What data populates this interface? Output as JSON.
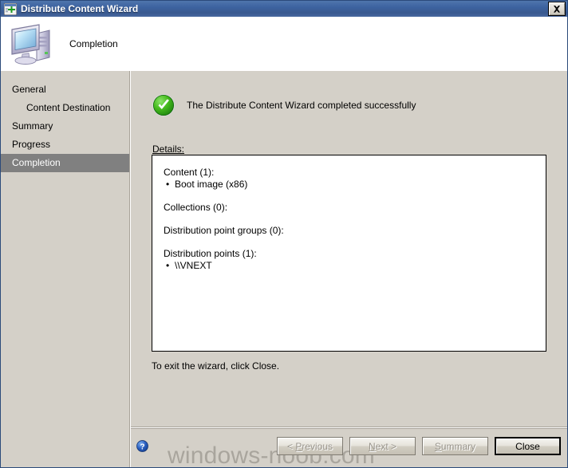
{
  "window": {
    "title": "Distribute Content Wizard",
    "title_icon": "wizard-window-plus-icon",
    "close_label": "X"
  },
  "header": {
    "title": "Completion",
    "icon": "computer-icon"
  },
  "sidebar": {
    "items": [
      {
        "label": "General",
        "sub": false,
        "active": false
      },
      {
        "label": "Content Destination",
        "sub": true,
        "active": false
      },
      {
        "label": "Summary",
        "sub": false,
        "active": false
      },
      {
        "label": "Progress",
        "sub": false,
        "active": false
      },
      {
        "label": "Completion",
        "sub": false,
        "active": true
      }
    ]
  },
  "content": {
    "success_icon": "green-check-circle-icon",
    "success_message": "The Distribute Content Wizard completed successfully",
    "details_label": "Details:",
    "details": [
      {
        "heading": "Content (1):",
        "bullets": [
          "Boot image (x86)"
        ]
      },
      {
        "heading": "Collections (0):",
        "bullets": []
      },
      {
        "heading": "Distribution point groups (0):",
        "bullets": []
      },
      {
        "heading": "Distribution points (1):",
        "bullets": [
          "\\\\VNEXT"
        ]
      }
    ],
    "exit_text": "To exit the wizard, click Close."
  },
  "footer": {
    "help_icon": "help-question-icon",
    "watermark": "windows-noob.com",
    "buttons": [
      {
        "label": "< Previous",
        "accel": "P",
        "disabled": true,
        "default": false
      },
      {
        "label": "Next >",
        "accel": "N",
        "disabled": true,
        "default": false
      },
      {
        "label": "Summary",
        "accel": "S",
        "disabled": true,
        "default": false
      },
      {
        "label": "Close",
        "accel": "",
        "disabled": false,
        "default": true
      }
    ]
  },
  "colors": {
    "title_bar": "#3d63a0",
    "dialog_face": "#d4d0c8",
    "nav_active": "#808080",
    "success_green": "#3aa81a",
    "watermark_gray": "#a9a59d"
  }
}
